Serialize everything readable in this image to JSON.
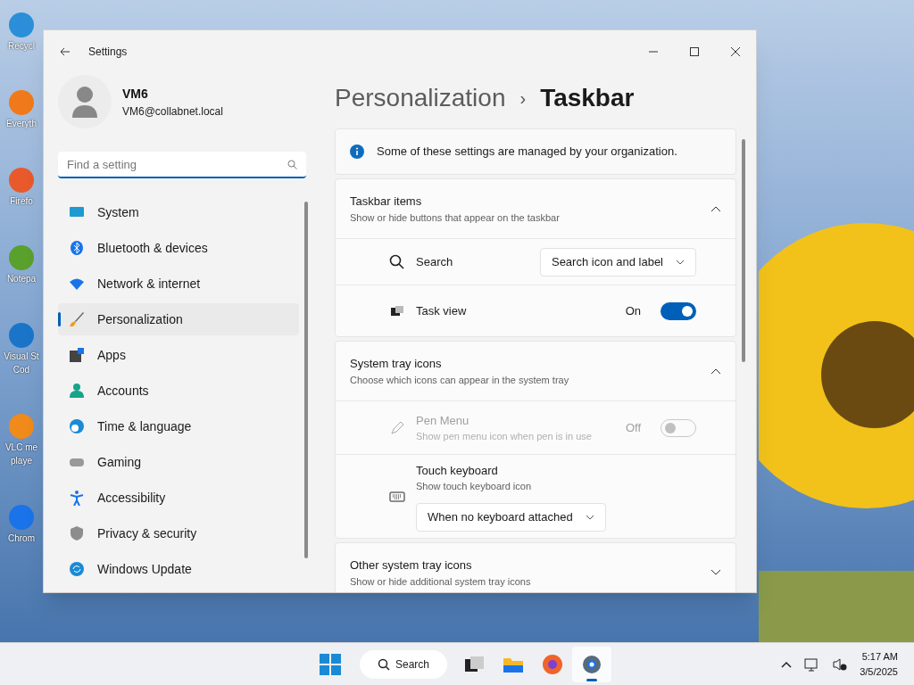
{
  "desktop_icons": [
    {
      "label": "Recycl"
    },
    {
      "label": "Everyth"
    },
    {
      "label": "Firefo"
    },
    {
      "label": "Notepa"
    },
    {
      "label": "Visual St",
      "label_2": "Cod"
    },
    {
      "label": "VLC me",
      "label_2": "playe"
    },
    {
      "label": "Chrom"
    }
  ],
  "window": {
    "title": "Settings"
  },
  "user": {
    "name": "VM6",
    "email": "VM6@collabnet.local"
  },
  "search": {
    "placeholder": "Find a setting"
  },
  "nav_items": [
    {
      "label": "System",
      "selected": false
    },
    {
      "label": "Bluetooth & devices",
      "selected": false
    },
    {
      "label": "Network & internet",
      "selected": false
    },
    {
      "label": "Personalization",
      "selected": true
    },
    {
      "label": "Apps",
      "selected": false
    },
    {
      "label": "Accounts",
      "selected": false
    },
    {
      "label": "Time & language",
      "selected": false
    },
    {
      "label": "Gaming",
      "selected": false
    },
    {
      "label": "Accessibility",
      "selected": false
    },
    {
      "label": "Privacy & security",
      "selected": false
    },
    {
      "label": "Windows Update",
      "selected": false
    }
  ],
  "breadcrumb": {
    "parent": "Personalization",
    "separator": "›",
    "current": "Taskbar"
  },
  "notice": "Some of these settings are managed by your organization.",
  "sections": [
    {
      "title": "Taskbar items",
      "subtitle": "Show or hide buttons that appear on the taskbar",
      "expanded": true,
      "rows": [
        {
          "kind": "dropdown",
          "label": "Search",
          "value": "Search icon and label",
          "disabled": false
        },
        {
          "kind": "toggle",
          "label": "Task view",
          "on": true,
          "state_text": "On",
          "disabled": false
        }
      ]
    },
    {
      "title": "System tray icons",
      "subtitle": "Choose which icons can appear in the system tray",
      "expanded": true,
      "rows": [
        {
          "kind": "toggle",
          "label": "Pen Menu",
          "description": "Show pen menu icon when pen is in use",
          "on": false,
          "state_text": "Off",
          "disabled": true
        },
        {
          "kind": "stacked_dropdown",
          "label": "Touch keyboard",
          "description": "Show touch keyboard icon",
          "value": "When no keyboard attached",
          "disabled": false
        }
      ]
    },
    {
      "title": "Other system tray icons",
      "subtitle": "Show or hide additional system tray icons",
      "expanded": false
    }
  ],
  "taskbar": {
    "search_label": "Search",
    "apps": [
      {
        "selected": false
      },
      {
        "selected": false
      },
      {
        "selected": false
      },
      {
        "selected": true
      }
    ],
    "time": "5:17 AM",
    "date": "3/5/2025"
  }
}
